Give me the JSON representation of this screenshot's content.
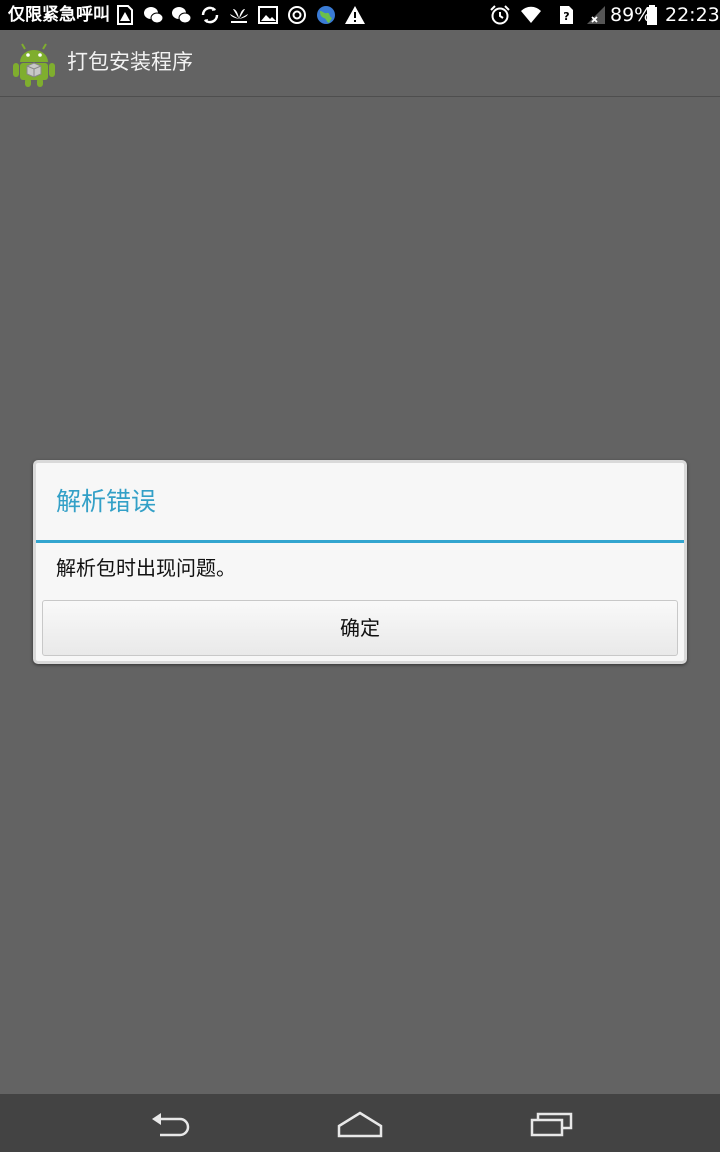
{
  "status_bar": {
    "carrier_text": "仅限紧急呼叫",
    "battery_percent": "89%",
    "time": "22:23",
    "icons": [
      "warning-doc-icon",
      "wechat-icon",
      "wechat-icon",
      "sync-icon",
      "huawei-icon",
      "image-icon",
      "settings-ring-icon",
      "globe-icon",
      "alert-icon",
      "alarm-icon",
      "wifi-icon",
      "sim-unknown-icon",
      "signal-none-icon",
      "battery-icon"
    ]
  },
  "action_bar": {
    "title": "打包安装程序",
    "icon": "android-package-icon"
  },
  "dialog": {
    "title": "解析错误",
    "message": "解析包时出现问题。",
    "ok_button": "确定",
    "accent_color": "#33a5cf"
  },
  "nav_bar": {
    "buttons": [
      "back-icon",
      "home-icon",
      "recent-apps-icon"
    ]
  }
}
